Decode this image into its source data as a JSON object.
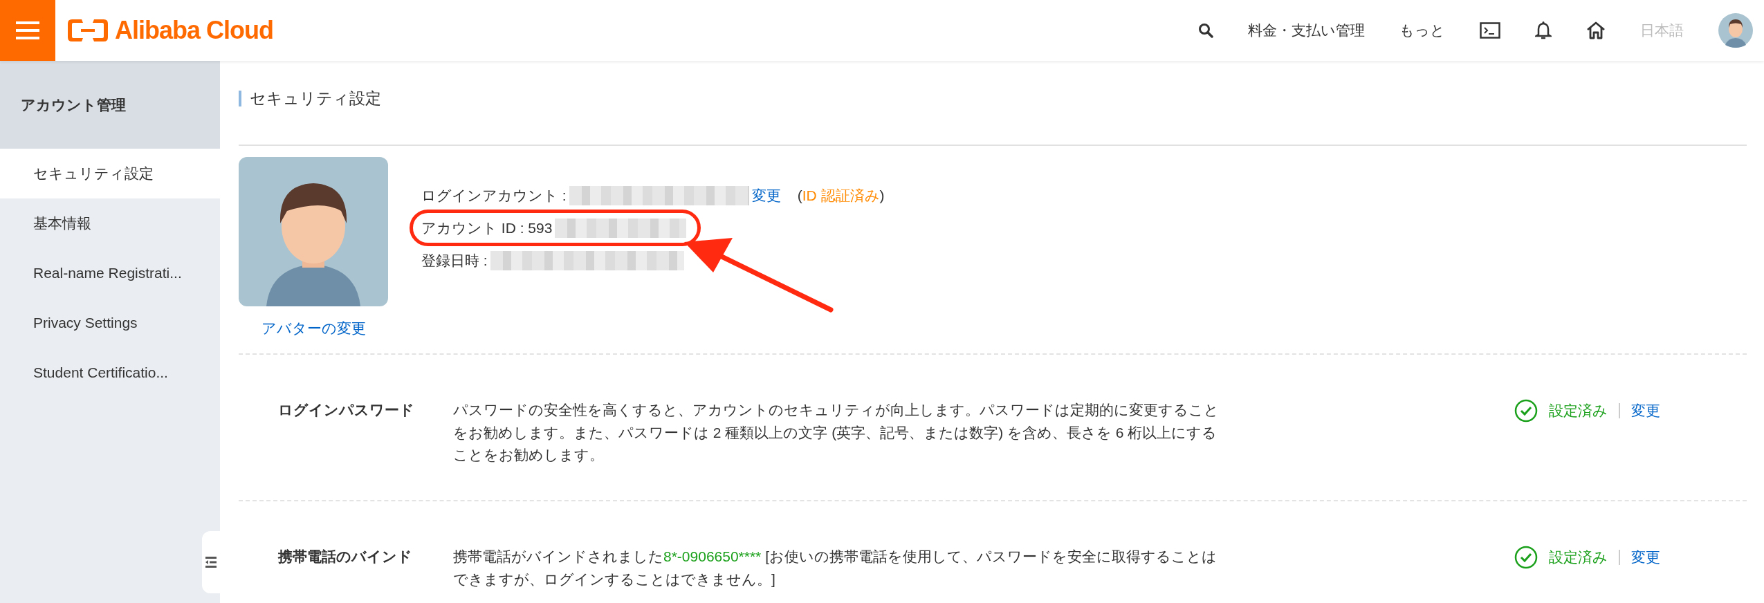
{
  "header": {
    "logo_text": "Alibaba Cloud",
    "links": [
      {
        "label": "料金・支払い管理",
        "disabled": false
      },
      {
        "label": "もっと",
        "disabled": false
      },
      {
        "label": "日本語",
        "disabled": true
      }
    ]
  },
  "sidebar": {
    "title": "アカウント管理",
    "items": [
      {
        "label": "セキュリティ設定",
        "selected": true
      },
      {
        "label": "基本情報",
        "selected": false
      },
      {
        "label": "Real-name Registrati...",
        "selected": false
      },
      {
        "label": "Privacy Settings",
        "selected": false
      },
      {
        "label": "Student Certificatio...",
        "selected": false
      }
    ]
  },
  "page_title": "セキュリティ設定",
  "profile": {
    "avatar_link": "アバターの変更",
    "fields": [
      {
        "label": "ログインアカウント :",
        "redacted": true,
        "highlighted": false,
        "link": "変更",
        "verified": {
          "open": "(",
          "label": "ID 認証済み",
          "close": ")"
        }
      },
      {
        "label": "アカウント ID : 593",
        "redacted": true,
        "highlighted": true
      },
      {
        "label": "登録日時 :",
        "redacted": true,
        "highlighted": false
      }
    ]
  },
  "security_items": [
    {
      "title": "ログインパスワード",
      "configured": true,
      "status": "設定済み",
      "action": "変更",
      "description": [
        {
          "kind": "text",
          "text": "パスワードの安全性を高くすると、アカウントのセキュリティが向上します。パスワードは定期的に変更することをお勧めします。また、パスワードは 2 種類以上の文字 (英字、記号、または数字) を含め、長さを 6 桁以上にすることをお勧めします。"
        }
      ]
    },
    {
      "title": "携帯電話のバインド",
      "configured": true,
      "status": "設定済み",
      "action": "変更",
      "description": [
        {
          "kind": "text",
          "text": "携帯電話がバインドされました"
        },
        {
          "kind": "phone",
          "text": "8*-0906650****"
        },
        {
          "kind": "text",
          "text": " [お使いの携帯電話を使用して、パスワードを安全に取得することはできますが、ログインすることはできません。]"
        }
      ]
    }
  ]
}
